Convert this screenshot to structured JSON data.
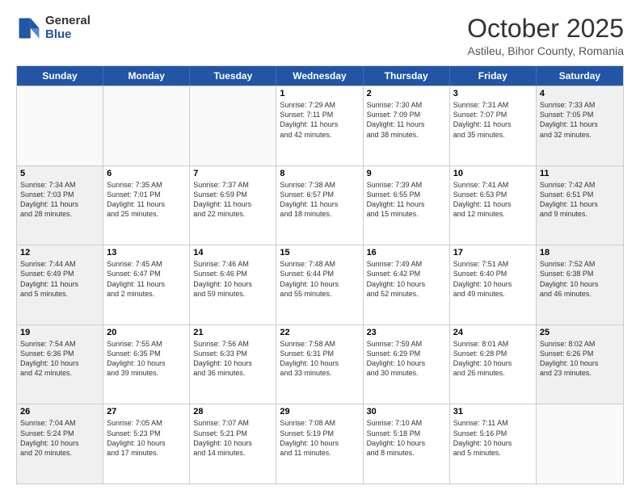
{
  "logo": {
    "general": "General",
    "blue": "Blue"
  },
  "header": {
    "month": "October 2025",
    "location": "Astileu, Bihor County, Romania"
  },
  "weekdays": [
    "Sunday",
    "Monday",
    "Tuesday",
    "Wednesday",
    "Thursday",
    "Friday",
    "Saturday"
  ],
  "weeks": [
    [
      {
        "day": "",
        "lines": [],
        "empty": true
      },
      {
        "day": "",
        "lines": [],
        "empty": true
      },
      {
        "day": "",
        "lines": [],
        "empty": true
      },
      {
        "day": "1",
        "lines": [
          "Sunrise: 7:29 AM",
          "Sunset: 7:11 PM",
          "Daylight: 11 hours",
          "and 42 minutes."
        ],
        "shaded": false
      },
      {
        "day": "2",
        "lines": [
          "Sunrise: 7:30 AM",
          "Sunset: 7:09 PM",
          "Daylight: 11 hours",
          "and 38 minutes."
        ],
        "shaded": false
      },
      {
        "day": "3",
        "lines": [
          "Sunrise: 7:31 AM",
          "Sunset: 7:07 PM",
          "Daylight: 11 hours",
          "and 35 minutes."
        ],
        "shaded": false
      },
      {
        "day": "4",
        "lines": [
          "Sunrise: 7:33 AM",
          "Sunset: 7:05 PM",
          "Daylight: 11 hours",
          "and 32 minutes."
        ],
        "shaded": true
      }
    ],
    [
      {
        "day": "5",
        "lines": [
          "Sunrise: 7:34 AM",
          "Sunset: 7:03 PM",
          "Daylight: 11 hours",
          "and 28 minutes."
        ],
        "shaded": true
      },
      {
        "day": "6",
        "lines": [
          "Sunrise: 7:35 AM",
          "Sunset: 7:01 PM",
          "Daylight: 11 hours",
          "and 25 minutes."
        ],
        "shaded": false
      },
      {
        "day": "7",
        "lines": [
          "Sunrise: 7:37 AM",
          "Sunset: 6:59 PM",
          "Daylight: 11 hours",
          "and 22 minutes."
        ],
        "shaded": false
      },
      {
        "day": "8",
        "lines": [
          "Sunrise: 7:38 AM",
          "Sunset: 6:57 PM",
          "Daylight: 11 hours",
          "and 18 minutes."
        ],
        "shaded": false
      },
      {
        "day": "9",
        "lines": [
          "Sunrise: 7:39 AM",
          "Sunset: 6:55 PM",
          "Daylight: 11 hours",
          "and 15 minutes."
        ],
        "shaded": false
      },
      {
        "day": "10",
        "lines": [
          "Sunrise: 7:41 AM",
          "Sunset: 6:53 PM",
          "Daylight: 11 hours",
          "and 12 minutes."
        ],
        "shaded": false
      },
      {
        "day": "11",
        "lines": [
          "Sunrise: 7:42 AM",
          "Sunset: 6:51 PM",
          "Daylight: 11 hours",
          "and 9 minutes."
        ],
        "shaded": true
      }
    ],
    [
      {
        "day": "12",
        "lines": [
          "Sunrise: 7:44 AM",
          "Sunset: 6:49 PM",
          "Daylight: 11 hours",
          "and 5 minutes."
        ],
        "shaded": true
      },
      {
        "day": "13",
        "lines": [
          "Sunrise: 7:45 AM",
          "Sunset: 6:47 PM",
          "Daylight: 11 hours",
          "and 2 minutes."
        ],
        "shaded": false
      },
      {
        "day": "14",
        "lines": [
          "Sunrise: 7:46 AM",
          "Sunset: 6:46 PM",
          "Daylight: 10 hours",
          "and 59 minutes."
        ],
        "shaded": false
      },
      {
        "day": "15",
        "lines": [
          "Sunrise: 7:48 AM",
          "Sunset: 6:44 PM",
          "Daylight: 10 hours",
          "and 55 minutes."
        ],
        "shaded": false
      },
      {
        "day": "16",
        "lines": [
          "Sunrise: 7:49 AM",
          "Sunset: 6:42 PM",
          "Daylight: 10 hours",
          "and 52 minutes."
        ],
        "shaded": false
      },
      {
        "day": "17",
        "lines": [
          "Sunrise: 7:51 AM",
          "Sunset: 6:40 PM",
          "Daylight: 10 hours",
          "and 49 minutes."
        ],
        "shaded": false
      },
      {
        "day": "18",
        "lines": [
          "Sunrise: 7:52 AM",
          "Sunset: 6:38 PM",
          "Daylight: 10 hours",
          "and 46 minutes."
        ],
        "shaded": true
      }
    ],
    [
      {
        "day": "19",
        "lines": [
          "Sunrise: 7:54 AM",
          "Sunset: 6:36 PM",
          "Daylight: 10 hours",
          "and 42 minutes."
        ],
        "shaded": true
      },
      {
        "day": "20",
        "lines": [
          "Sunrise: 7:55 AM",
          "Sunset: 6:35 PM",
          "Daylight: 10 hours",
          "and 39 minutes."
        ],
        "shaded": false
      },
      {
        "day": "21",
        "lines": [
          "Sunrise: 7:56 AM",
          "Sunset: 6:33 PM",
          "Daylight: 10 hours",
          "and 36 minutes."
        ],
        "shaded": false
      },
      {
        "day": "22",
        "lines": [
          "Sunrise: 7:58 AM",
          "Sunset: 6:31 PM",
          "Daylight: 10 hours",
          "and 33 minutes."
        ],
        "shaded": false
      },
      {
        "day": "23",
        "lines": [
          "Sunrise: 7:59 AM",
          "Sunset: 6:29 PM",
          "Daylight: 10 hours",
          "and 30 minutes."
        ],
        "shaded": false
      },
      {
        "day": "24",
        "lines": [
          "Sunrise: 8:01 AM",
          "Sunset: 6:28 PM",
          "Daylight: 10 hours",
          "and 26 minutes."
        ],
        "shaded": false
      },
      {
        "day": "25",
        "lines": [
          "Sunrise: 8:02 AM",
          "Sunset: 6:26 PM",
          "Daylight: 10 hours",
          "and 23 minutes."
        ],
        "shaded": true
      }
    ],
    [
      {
        "day": "26",
        "lines": [
          "Sunrise: 7:04 AM",
          "Sunset: 5:24 PM",
          "Daylight: 10 hours",
          "and 20 minutes."
        ],
        "shaded": true
      },
      {
        "day": "27",
        "lines": [
          "Sunrise: 7:05 AM",
          "Sunset: 5:23 PM",
          "Daylight: 10 hours",
          "and 17 minutes."
        ],
        "shaded": false
      },
      {
        "day": "28",
        "lines": [
          "Sunrise: 7:07 AM",
          "Sunset: 5:21 PM",
          "Daylight: 10 hours",
          "and 14 minutes."
        ],
        "shaded": false
      },
      {
        "day": "29",
        "lines": [
          "Sunrise: 7:08 AM",
          "Sunset: 5:19 PM",
          "Daylight: 10 hours",
          "and 11 minutes."
        ],
        "shaded": false
      },
      {
        "day": "30",
        "lines": [
          "Sunrise: 7:10 AM",
          "Sunset: 5:18 PM",
          "Daylight: 10 hours",
          "and 8 minutes."
        ],
        "shaded": false
      },
      {
        "day": "31",
        "lines": [
          "Sunrise: 7:11 AM",
          "Sunset: 5:16 PM",
          "Daylight: 10 hours",
          "and 5 minutes."
        ],
        "shaded": false
      },
      {
        "day": "",
        "lines": [],
        "empty": true
      }
    ]
  ]
}
